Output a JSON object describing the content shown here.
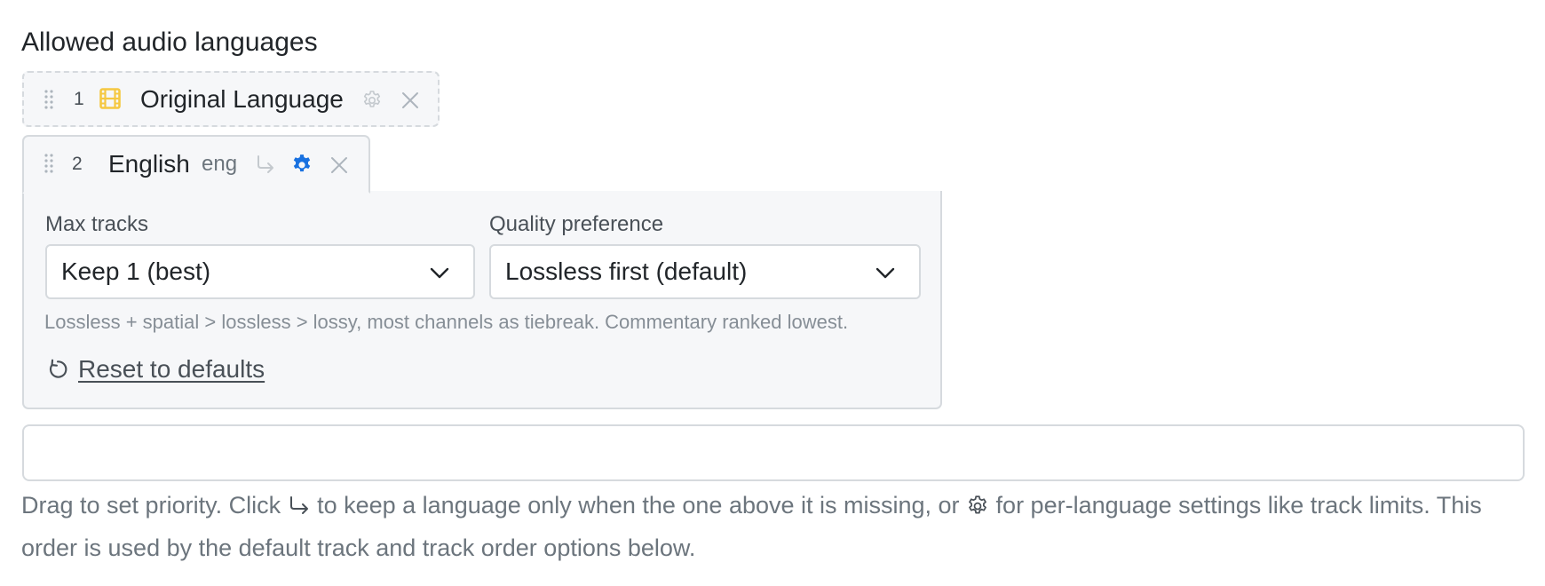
{
  "section": {
    "title": "Allowed audio languages"
  },
  "languages": [
    {
      "position": "1",
      "name": "Original Language",
      "code": "",
      "icon": "film-icon",
      "settings_active": false
    },
    {
      "position": "2",
      "name": "English",
      "code": "eng",
      "icon": "",
      "settings_active": true
    }
  ],
  "settings": {
    "max_tracks_label": "Max tracks",
    "max_tracks_value": "Keep 1 (best)",
    "quality_label": "Quality preference",
    "quality_value": "Lossless first (default)",
    "quality_help": "Lossless + spatial > lossless > lossy, most channels as tiebreak. Commentary ranked lowest.",
    "reset_label": "Reset to defaults"
  },
  "add_language": {
    "value": ""
  },
  "footer": {
    "part1": "Drag to set priority. Click ",
    "part2": " to keep a language only when the one above it is missing, or ",
    "part3": " for per-language settings like track limits. This order is used by the default track and track order options below."
  },
  "colors": {
    "accent": "#1971e0",
    "film_icon": "#f5c842",
    "border": "#d6dade",
    "panel_bg": "#f6f7f9",
    "muted_text": "#6c757d"
  }
}
